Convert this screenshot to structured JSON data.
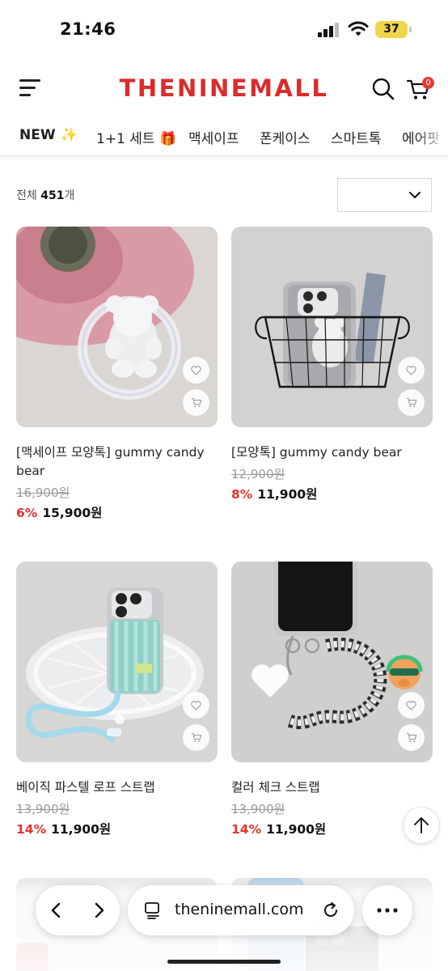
{
  "status": {
    "time": "21:46",
    "battery": "37"
  },
  "header": {
    "logo": "THENINEMALL",
    "cart_count": "0"
  },
  "categories": [
    "NEW ✨",
    "1+1 세트 🎁",
    "맥세이프",
    "폰케이스",
    "스마트톡",
    "에어팟"
  ],
  "listing": {
    "count_prefix": "전체",
    "count_value": "451",
    "count_suffix": "개",
    "sort_value": ""
  },
  "products": [
    {
      "name": "[맥세이프 모양톡] gummy candy bear",
      "original_price": "16,900원",
      "discount": "6%",
      "price": "15,900원"
    },
    {
      "name": "[모양톡] gummy candy bear",
      "original_price": "12,900원",
      "discount": "8%",
      "price": "11,900원"
    },
    {
      "name": "베이직 파스텔 로프 스트랩",
      "original_price": "13,900원",
      "discount": "14%",
      "price": "11,900원"
    },
    {
      "name": "컬러 체크 스트랩",
      "original_price": "13,900원",
      "discount": "14%",
      "price": "11,900원"
    }
  ],
  "browser": {
    "url": "theninemall.com"
  },
  "colors": {
    "brand": "#dc2b2b",
    "discount": "#e3342f",
    "battery": "#f1d44a"
  }
}
